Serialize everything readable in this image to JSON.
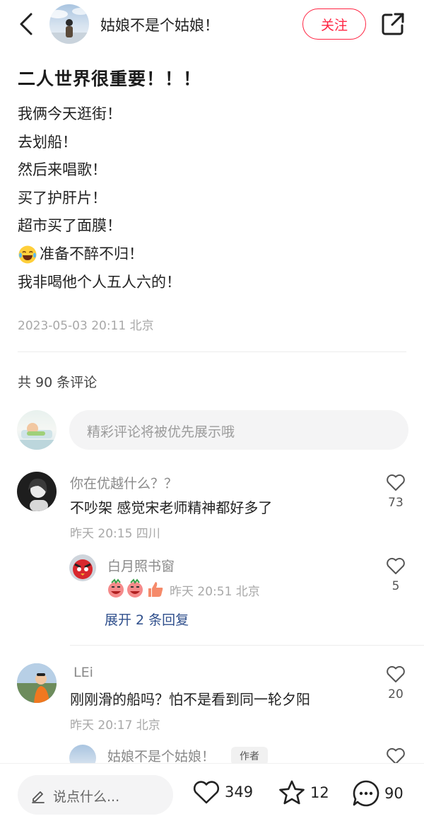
{
  "header": {
    "author_name": "姑娘不是个姑娘！",
    "follow_label": "关注"
  },
  "post": {
    "title": "二人世界很重要！！！",
    "lines": [
      "我俩今天逛街！",
      "去划船！",
      "然后来唱歌！",
      "买了护肝片！",
      "超市买了面膜！",
      "准备不醉不归！",
      "我非喝他个人五人六的！"
    ],
    "meta": "2023-05-03 20:11 北京"
  },
  "comments_section": {
    "count_label": "共 90 条评论",
    "input_placeholder": "精彩评论将被优先展示哦"
  },
  "comments": [
    {
      "user": "你在优越什么？？",
      "text": "不吵架 感觉宋老师精神都好多了",
      "meta": "昨天 20:15 四川",
      "likes": "73",
      "replies": [
        {
          "user": "白月照书窗",
          "meta": "昨天 20:51 北京",
          "likes": "5"
        }
      ],
      "expand_label": "展开 2 条回复"
    },
    {
      "user": "LEi",
      "text": "刚刚滑的船吗？怕不是看到同一轮夕阳",
      "meta": "昨天 20:17 北京",
      "likes": "20",
      "replies": [
        {
          "user": "姑娘不是个姑娘！",
          "badge": "作者"
        }
      ]
    }
  ],
  "bottom_bar": {
    "say_placeholder": "说点什么...",
    "likes": "349",
    "stars": "12",
    "comments": "90"
  },
  "colors": {
    "accent": "#ff2442",
    "link": "#2f4f8c"
  }
}
